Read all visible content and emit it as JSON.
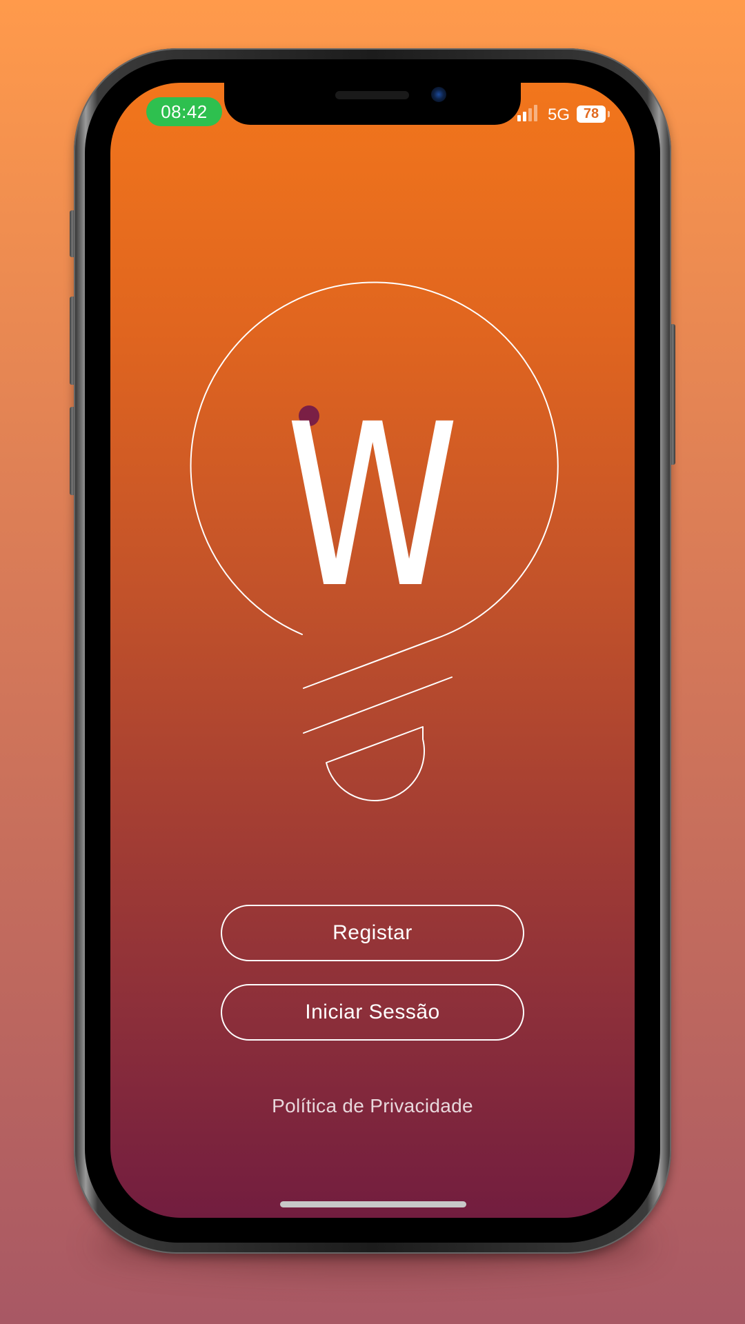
{
  "status_bar": {
    "time": "08:42",
    "network": "5G",
    "battery": "78"
  },
  "logo": {
    "letter": "W"
  },
  "actions": {
    "register_label": "Registar",
    "login_label": "Iniciar Sessão"
  },
  "footer": {
    "privacy_label": "Política de Privacidade"
  },
  "colors": {
    "screen_top": "#F2761C",
    "screen_bottom": "#721D3F",
    "time_pill": "#2EC04F",
    "logo_dot": "#7A1F45"
  },
  "icons": [
    "signal-icon",
    "battery-icon",
    "lightbulb-logo-icon"
  ]
}
